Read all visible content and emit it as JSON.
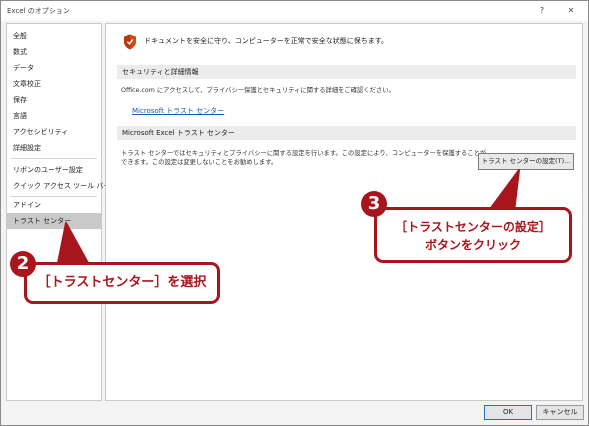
{
  "window": {
    "title": "Excel のオプション",
    "help_label": "?",
    "close_label": "✕"
  },
  "sidebar": {
    "items": [
      {
        "label": "全般"
      },
      {
        "label": "数式"
      },
      {
        "label": "データ"
      },
      {
        "label": "文章校正"
      },
      {
        "label": "保存"
      },
      {
        "label": "言語"
      },
      {
        "label": "アクセシビリティ"
      },
      {
        "label": "詳細設定"
      },
      {
        "label": "リボンのユーザー設定"
      },
      {
        "label": "クイック アクセス ツール バー"
      },
      {
        "label": "アドイン"
      },
      {
        "label": "トラスト センター"
      }
    ],
    "selected_index": 11
  },
  "content": {
    "intro": "ドキュメントを安全に守り、コンピューターを正常で安全な状態に保ちます。",
    "privacy": {
      "heading": "セキュリティと詳細情報",
      "text": "Office.com にアクセスして、プライバシー保護とセキュリティに関する詳細をご確認ください。",
      "link": "Microsoft トラスト センター"
    },
    "trust_center": {
      "heading": "Microsoft Excel トラスト センター",
      "text_line1": "トラスト センターではセキュリティとプライバシーに関する設定を行います。この設定により、コンピューターを保護することが",
      "text_line2": "できます。この設定は変更しないことをお勧めします。",
      "button": "トラスト センターの設定(T)..."
    }
  },
  "footer": {
    "ok": "OK",
    "cancel": "キャンセル"
  },
  "annotations": {
    "callout2": {
      "number": "2",
      "text": "［トラストセンター］を選択"
    },
    "callout3": {
      "number": "3",
      "line1": "［トラストセンターの設定］",
      "line2": "ボタンをクリック"
    }
  },
  "colors": {
    "accent": "#a8161d",
    "link": "#1a5aa8",
    "selected": "#c9c9c9",
    "shield": "#d04a17"
  },
  "icons": {
    "shield": "shield-icon"
  }
}
